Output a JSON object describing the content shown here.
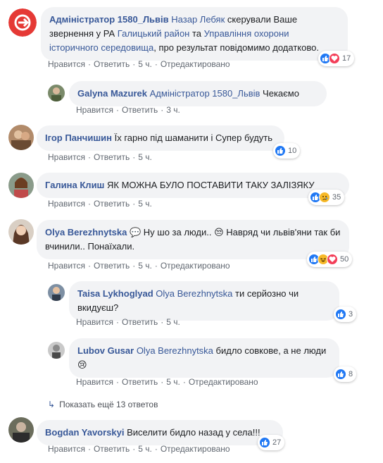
{
  "actions": {
    "like": "Нравится",
    "reply": "Ответить",
    "edited": "Отредактировано"
  },
  "colors": {
    "link": "#385898",
    "bubble": "#f2f3f5",
    "like": "#2078f4",
    "love": "#f33e58",
    "emoji": "#f7b928"
  },
  "comments": [
    {
      "author": "Адміністратор 1580_Львів",
      "mention": "Назар Лебяк",
      "text1": " скерували Ваше звернення у РА ",
      "link1": "Галицький район",
      "text2": " та ",
      "link2": "Управління охорони історичного середовища",
      "text3": ", про результат повідомимо додатково.",
      "time": "5 ч.",
      "reactions": [
        "like-icon",
        "love-icon"
      ],
      "reaction_count": "17"
    },
    {
      "author": "Galyna Mazurek",
      "mention": "Адміністратор 1580_Львів",
      "text": " Чекаємо",
      "time": "3 ч."
    },
    {
      "author": "Ігор Панчишин",
      "text": " Їх гарно під шаманити і Супер будуть",
      "time": "5 ч.",
      "reactions": [
        "like-icon"
      ],
      "reaction_count": "10"
    },
    {
      "author": "Галина Клиш",
      "text": " ЯК МОЖНА БУЛО ПОСТАВИТИ ТАКУ ЗАЛІЗЯКУ",
      "time": "5 ч.",
      "reactions": [
        "like-icon",
        "sad-icon"
      ],
      "reaction_count": "35"
    },
    {
      "author": "Olya Berezhnytska",
      "text": " Ну шо за люди.. 😒 Навряд чи львів'яни так би вчинили.. Понаїхали.",
      "time": "5 ч.",
      "reactions": [
        "like-icon",
        "haha-icon",
        "love-icon"
      ],
      "reaction_count": "50"
    },
    {
      "author": "Taisa Lykhoglyad",
      "mention": "Olya Berezhnytska",
      "text": " ти серйозно чи вкидуєш?",
      "time": "5 ч.",
      "reactions": [
        "like-icon"
      ],
      "reaction_count": "3"
    },
    {
      "author": "Lubov Gusar",
      "mention": "Olya Berezhnytska",
      "text": " бидло совкове, а не люди",
      "emoji": "😢",
      "time": "5 ч.",
      "reactions": [
        "like-icon"
      ],
      "reaction_count": "8"
    },
    {
      "author": "Bogdan Yavorskyi",
      "text": " Виселити бидло назад у села!!!",
      "time": "5 ч.",
      "reactions": [
        "like-icon"
      ],
      "reaction_count": "27"
    }
  ],
  "more_replies": "Показать ещё 13 ответов",
  "icons": {
    "reply_arrow": "↳",
    "messenger": "💬"
  }
}
